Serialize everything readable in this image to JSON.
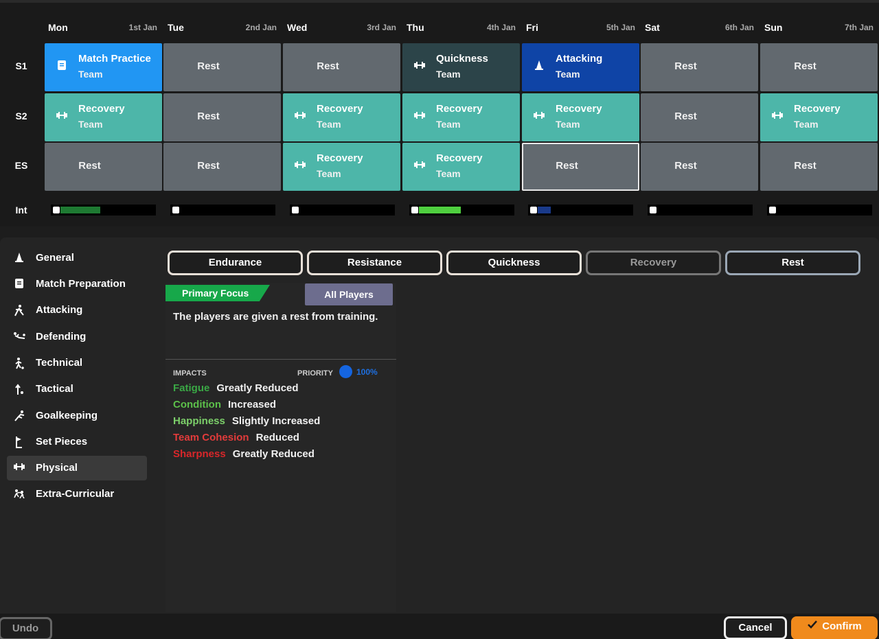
{
  "days": [
    {
      "name": "Mon",
      "date": "1st Jan"
    },
    {
      "name": "Tue",
      "date": "2nd Jan"
    },
    {
      "name": "Wed",
      "date": "3rd Jan"
    },
    {
      "name": "Thu",
      "date": "4th Jan"
    },
    {
      "name": "Fri",
      "date": "5th Jan"
    },
    {
      "name": "Sat",
      "date": "6th Jan"
    },
    {
      "name": "Sun",
      "date": "7th Jan"
    }
  ],
  "rows": {
    "s1": "S1",
    "s2": "S2",
    "es": "ES",
    "int": "Int"
  },
  "sessions": {
    "s1": [
      {
        "title": "Match Practice",
        "sub": "Team"
      },
      {
        "title": "Rest"
      },
      {
        "title": "Rest"
      },
      {
        "title": "Quickness",
        "sub": "Team"
      },
      {
        "title": "Attacking",
        "sub": "Team"
      },
      {
        "title": "Rest"
      },
      {
        "title": "Rest"
      }
    ],
    "s2": [
      {
        "title": "Recovery",
        "sub": "Team"
      },
      {
        "title": "Rest"
      },
      {
        "title": "Recovery",
        "sub": "Team"
      },
      {
        "title": "Recovery",
        "sub": "Team"
      },
      {
        "title": "Recovery",
        "sub": "Team"
      },
      {
        "title": "Rest"
      },
      {
        "title": "Recovery",
        "sub": "Team"
      }
    ],
    "es": [
      {
        "title": "Rest"
      },
      {
        "title": "Rest"
      },
      {
        "title": "Recovery",
        "sub": "Team"
      },
      {
        "title": "Recovery",
        "sub": "Team"
      },
      {
        "title": "Rest"
      },
      {
        "title": "Rest"
      },
      {
        "title": "Rest"
      }
    ]
  },
  "intensity": [
    {
      "level": 0.43,
      "color": "#1e7a32"
    },
    {
      "level": 0,
      "color": "#000000"
    },
    {
      "level": 0,
      "color": "#000000"
    },
    {
      "level": 0.45,
      "color": "#4fcf3f"
    },
    {
      "level": 0.14,
      "color": "#1a3a8a"
    },
    {
      "level": 0,
      "color": "#000000"
    },
    {
      "level": 0,
      "color": "#000000"
    }
  ],
  "sidebar": {
    "items": [
      {
        "label": "General",
        "icon": "cone-icon"
      },
      {
        "label": "Match Preparation",
        "icon": "notepad-icon"
      },
      {
        "label": "Attacking",
        "icon": "runner-icon"
      },
      {
        "label": "Defending",
        "icon": "slide-tackle-icon"
      },
      {
        "label": "Technical",
        "icon": "player-ball-icon"
      },
      {
        "label": "Tactical",
        "icon": "tactics-arrow-icon"
      },
      {
        "label": "Goalkeeping",
        "icon": "goalkeeper-icon"
      },
      {
        "label": "Set Pieces",
        "icon": "corner-flag-icon"
      },
      {
        "label": "Physical",
        "icon": "dumbbell-icon"
      },
      {
        "label": "Extra-Curricular",
        "icon": "social-icon"
      }
    ],
    "active": "Physical"
  },
  "categories": [
    "Endurance",
    "Resistance",
    "Quickness",
    "Recovery",
    "Rest"
  ],
  "detail": {
    "primary_focus": "Primary Focus",
    "all_players": "All Players",
    "description": "The players are given a rest from training.",
    "impacts_label": "IMPACTS",
    "priority_label": "PRIORITY",
    "priority_value": "100%",
    "impacts": [
      {
        "name": "Fatigue",
        "value": "Greatly Reduced",
        "color": "#3aa845"
      },
      {
        "name": "Condition",
        "value": "Increased",
        "color": "#5cc04a"
      },
      {
        "name": "Happiness",
        "value": "Slightly Increased",
        "color": "#7ccf6a"
      },
      {
        "name": "Team Cohesion",
        "value": "Reduced",
        "color": "#e23b3b"
      },
      {
        "name": "Sharpness",
        "value": "Greatly Reduced",
        "color": "#d8262a"
      }
    ]
  },
  "footer": {
    "undo": "Undo",
    "cancel": "Cancel",
    "confirm": "Confirm"
  },
  "colors": {
    "accent": "#f08a1c",
    "recovery": "#4db6a9",
    "rest": "#62696f",
    "match": "#2196f3",
    "attacking": "#0f44a6",
    "quickness": "#2c4449"
  }
}
